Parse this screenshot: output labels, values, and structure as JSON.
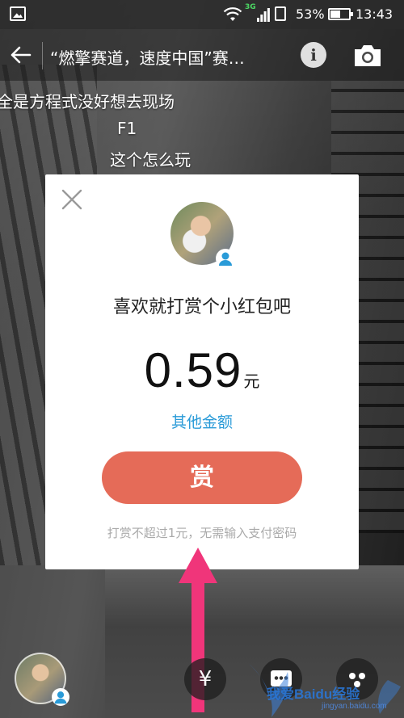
{
  "status_bar": {
    "network_label": "3G",
    "battery_percent": "53%",
    "time": "13:43",
    "icons": [
      "gallery-icon",
      "wifi-icon",
      "signal-icon",
      "sim-icon",
      "battery-icon"
    ]
  },
  "header": {
    "title": "“燃擎赛道，速度中国”赛…",
    "back_icon": "arrow-left-icon",
    "info_label": "i",
    "camera_icon": "camera-icon"
  },
  "comments": [
    {
      "text": "全是方程式没好想去现场"
    },
    {
      "text": "F1"
    },
    {
      "text": "这个怎么玩"
    }
  ],
  "reward_dialog": {
    "close_icon": "close-icon",
    "heading": "喜欢就打赏个小红包吧",
    "amount": "0.59",
    "amount_unit": "元",
    "other_amount_link": "其他金额",
    "reward_button_label": "赏",
    "note": "打赏不超过1元，无需输入支付密码"
  },
  "bottom_bar": {
    "yuan_label": "¥",
    "chat_icon": "chat-icon",
    "more_icon": "more-icon"
  },
  "watermark": {
    "text": "我爱Baidu经验",
    "sub": "jingyan.baidu.com"
  },
  "colors": {
    "accent_blue": "#2a9bd8",
    "reward_button": "#e56b58",
    "annotation_arrow": "#f0357a"
  }
}
